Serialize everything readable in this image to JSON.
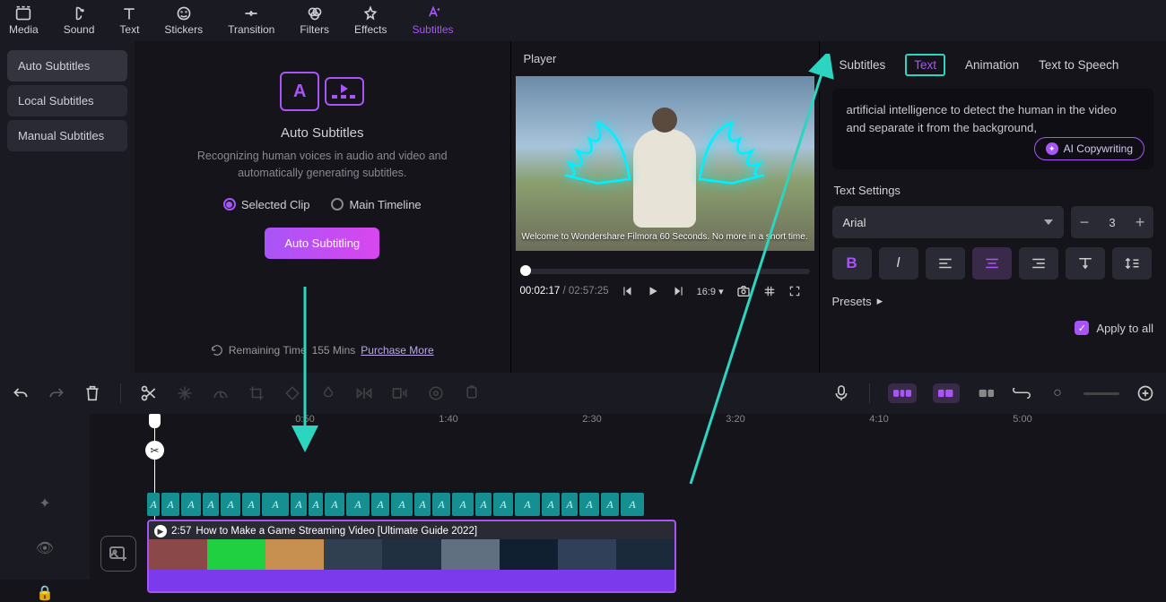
{
  "top_tabs": {
    "media": "Media",
    "sound": "Sound",
    "text": "Text",
    "stickers": "Stickers",
    "transition": "Transition",
    "filters": "Filters",
    "effects": "Effects",
    "subtitles": "Subtitles"
  },
  "subtitle_modes": {
    "auto": "Auto Subtitles",
    "local": "Local Subtitles",
    "manual": "Manual Subtitles"
  },
  "auto_panel": {
    "title": "Auto Subtitles",
    "desc": "Recognizing human voices in audio and video and automatically generating subtitles.",
    "opt_selected_clip": "Selected Clip",
    "opt_main_timeline": "Main Timeline",
    "button": "Auto Subtitling",
    "remaining_label": "Remaining Time",
    "remaining_value": "155 Mins",
    "purchase": "Purchase More"
  },
  "player": {
    "title": "Player",
    "caption": "Welcome to Wondershare Filmora 60 Seconds. No more in a short time.",
    "current_time": "00:02:17",
    "duration": "02:57:25",
    "aspect": "16:9"
  },
  "inspector": {
    "tabs": {
      "subtitles": "Subtitles",
      "text": "Text",
      "animation": "Animation",
      "tts": "Text to Speech"
    },
    "text_content": "artificial intelligence to detect the human in the video and separate it from the background,",
    "ai_btn": "AI Copywriting",
    "text_settings_label": "Text Settings",
    "font": "Arial",
    "size": "3",
    "presets_label": "Presets",
    "apply_all": "Apply to all"
  },
  "timeline": {
    "ticks": [
      "0:50",
      "1:40",
      "2:30",
      "3:20",
      "4:10",
      "5:00"
    ],
    "clip_time": "2:57",
    "clip_title": "How to Make a Game Streaming Video [Ultimate Guide 2022]"
  }
}
